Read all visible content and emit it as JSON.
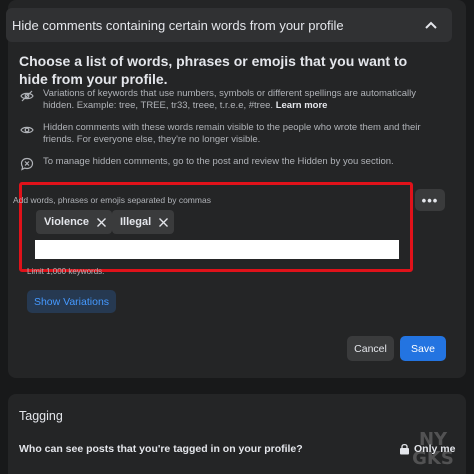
{
  "filter_panel": {
    "header_title": "Hide comments containing certain words from your profile",
    "heading": "Choose a list of words, phrases or emojis that you want to hide from your profile.",
    "info": [
      {
        "icon": "eye-off-icon",
        "text": "Variations of keywords that use numbers, symbols or different spellings are automatically hidden. Example: tree, TREE, tr33, treee, t.r.e.e, #tree.",
        "link": "Learn more"
      },
      {
        "icon": "eye-icon",
        "text": "Hidden comments with these words remain visible to the people who wrote them and their friends. For everyone else, they're no longer visible.",
        "link": ""
      },
      {
        "icon": "comment-x-icon",
        "text": "To manage hidden comments, go to the post and review the Hidden by you section.",
        "link": ""
      }
    ],
    "input_label": "Add words, phrases or emojis separated by commas",
    "keywords": [
      "Violence",
      "Illegal"
    ],
    "input_value": "",
    "more_label": "•••",
    "limit_text": "Limit 1,000 keywords.",
    "show_variations_label": "Show Variations",
    "cancel_label": "Cancel",
    "save_label": "Save",
    "highlight_color": "#e0121a",
    "accent_color": "#2374e1"
  },
  "tagging_panel": {
    "title": "Tagging",
    "question": "Who can see posts that you're tagged in on your profile?",
    "audience_label": "Only me"
  },
  "watermark": {
    "line1": "NY",
    "line2": "GKS"
  }
}
